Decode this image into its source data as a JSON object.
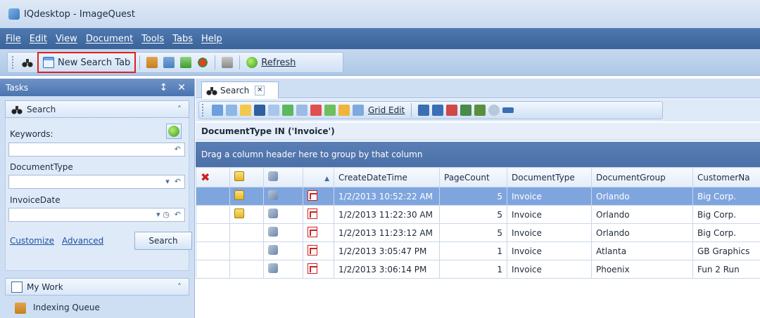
{
  "window": {
    "title": "IQdesktop - ImageQuest"
  },
  "menu": [
    "File",
    "Edit",
    "View",
    "Document",
    "Tools",
    "Tabs",
    "Help"
  ],
  "toolbar": {
    "new_search_tab": "New Search Tab",
    "refresh": "Refresh"
  },
  "tasks_panel": {
    "title": "Tasks",
    "pin": "↕",
    "close": "✕",
    "search_group": {
      "title": "Search",
      "collapse": "˄",
      "keywords_label": "Keywords:",
      "document_type_label": "DocumentType",
      "invoice_date_label": "InvoiceDate",
      "customize": "Customize",
      "advanced": "Advanced",
      "search_button": "Search"
    },
    "my_work_group": {
      "title": "My Work",
      "collapse": "˄",
      "items": [
        "Indexing Queue"
      ]
    }
  },
  "tab": {
    "label": "Search",
    "close": "✕"
  },
  "grid_toolbar": {
    "grid_edit": "Grid Edit"
  },
  "filter_text": "DocumentType IN ('Invoice')",
  "group_hint": "Drag a column header here to group by that column",
  "grid": {
    "columns": [
      "CreateDateTime",
      "PageCount",
      "DocumentType",
      "DocumentGroup",
      "CustomerNa"
    ],
    "sort_indicator": "▲",
    "rows": [
      {
        "note": true,
        "create": "1/2/2013 10:52:22 AM",
        "pages": "5",
        "type": "Invoice",
        "group": "Orlando",
        "customer": "Big Corp.",
        "selected": true
      },
      {
        "note": true,
        "create": "1/2/2013 11:22:30 AM",
        "pages": "5",
        "type": "Invoice",
        "group": "Orlando",
        "customer": "Big Corp."
      },
      {
        "note": false,
        "create": "1/2/2013 11:23:12 AM",
        "pages": "5",
        "type": "Invoice",
        "group": "Orlando",
        "customer": "Big Corp."
      },
      {
        "note": false,
        "create": "1/2/2013 3:05:47 PM",
        "pages": "1",
        "type": "Invoice",
        "group": "Atlanta",
        "customer": "GB Graphics"
      },
      {
        "note": false,
        "create": "1/2/2013 3:06:14 PM",
        "pages": "1",
        "type": "Invoice",
        "group": "Phoenix",
        "customer": "Fun 2 Run"
      }
    ]
  },
  "colors": {
    "highlight": "#e02020",
    "selected_row": "#7fa5de",
    "menubar": "#3a6499",
    "group_hint": "#4b6fa7"
  }
}
